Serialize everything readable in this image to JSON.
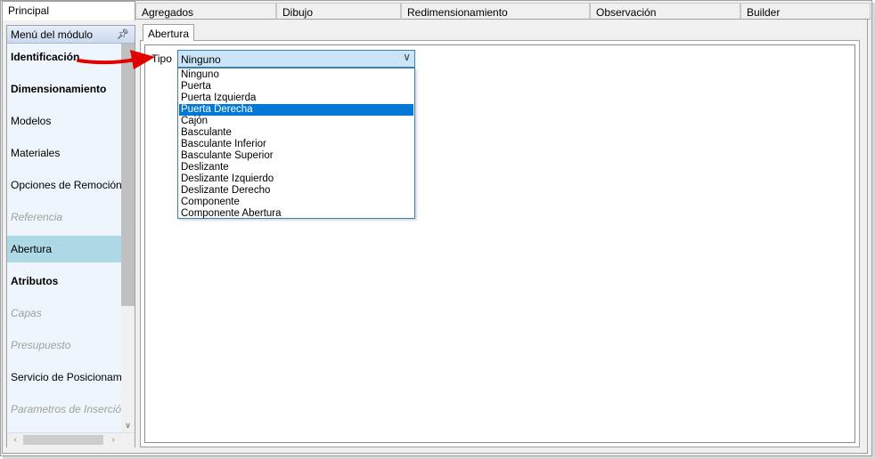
{
  "top_tabs": [
    "Principal",
    "Agregados",
    "Dibujo",
    "Redimensionamiento",
    "Observación",
    "Builder"
  ],
  "module_panel": {
    "title": "Menú del módulo",
    "items": [
      {
        "label": "Identificación",
        "style": "bold"
      },
      {
        "label": "Dimensionamiento",
        "style": "bold"
      },
      {
        "label": "Modelos",
        "style": "normal"
      },
      {
        "label": "Materiales",
        "style": "normal"
      },
      {
        "label": "Opciones de Remoción",
        "style": "normal"
      },
      {
        "label": "Referencia",
        "style": "disabled"
      },
      {
        "label": "Abertura",
        "style": "selected"
      },
      {
        "label": "Atributos",
        "style": "bold"
      },
      {
        "label": "Capas",
        "style": "disabled"
      },
      {
        "label": "Presupuesto",
        "style": "disabled"
      },
      {
        "label": "Servicio de Posicionamiento",
        "style": "normal"
      },
      {
        "label": "Parametros de Inserción",
        "style": "disabled"
      }
    ]
  },
  "inner_tab": "Abertura",
  "tipo": {
    "label": "Tipo",
    "value": "Ninguno",
    "options": [
      "Ninguno",
      "Puerta",
      "Puerta Izquierda",
      "Puerta Derecha",
      "Cajón",
      "Basculante",
      "Basculante Inferior",
      "Basculante Superior",
      "Deslizante",
      "Deslizante Izquierdo",
      "Deslizante Derecho",
      "Componente",
      "Componente Abertura"
    ],
    "highlighted_option": "Puerta Derecha"
  },
  "colors": {
    "selected_module_bg": "#add8e6",
    "dropdown_highlight": "#0078d7",
    "annotation_arrow": "#e00000"
  }
}
